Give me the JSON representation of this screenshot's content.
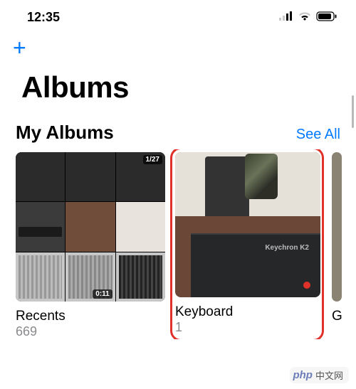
{
  "status": {
    "time": "12:35"
  },
  "toolbar": {
    "add_label": "+"
  },
  "page": {
    "title": "Albums"
  },
  "section": {
    "title": "My Albums",
    "see_all": "See All"
  },
  "albums": [
    {
      "name": "Recents",
      "count": "669",
      "badges": {
        "top_right": "1/27",
        "bottom_mid": "0:11"
      }
    },
    {
      "name": "Keyboard",
      "count": "1",
      "box_label": "Keychron K2"
    },
    {
      "name": "G"
    }
  ],
  "watermark": {
    "brand": "php",
    "text": "中文网"
  },
  "colors": {
    "accent": "#007aff",
    "highlight": "#e0312b"
  }
}
